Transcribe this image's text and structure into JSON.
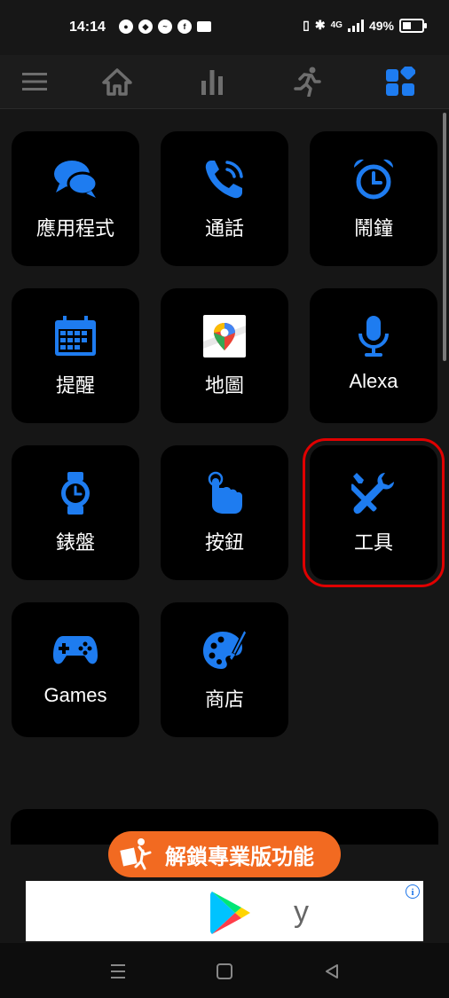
{
  "status_bar": {
    "time": "14:14",
    "notification_icons": [
      "line-icon",
      "discord-icon",
      "messenger-icon",
      "facebook-icon",
      "mail-icon"
    ],
    "network": "4G",
    "battery": "49%"
  },
  "navbar": {
    "items": [
      "menu-icon",
      "home-icon",
      "stats-icon",
      "running-icon",
      "apps-icon"
    ],
    "active": "apps-icon",
    "accent": "#1e7cf0"
  },
  "tiles": [
    {
      "label": "應用程式",
      "icon": "chat-bubbles-icon"
    },
    {
      "label": "通話",
      "icon": "phone-call-icon"
    },
    {
      "label": "鬧鐘",
      "icon": "alarm-clock-icon"
    },
    {
      "label": "提醒",
      "icon": "calendar-icon"
    },
    {
      "label": "地圖",
      "icon": "google-maps-icon"
    },
    {
      "label": "Alexa",
      "icon": "microphone-icon"
    },
    {
      "label": "錶盤",
      "icon": "watch-icon"
    },
    {
      "label": "按鈕",
      "icon": "tap-hand-icon"
    },
    {
      "label": "工具",
      "icon": "tools-icon",
      "highlighted": true
    },
    {
      "label": "Games",
      "icon": "gamepad-icon"
    },
    {
      "label": "商店",
      "icon": "palette-icon"
    }
  ],
  "unlock_button": {
    "label": "解鎖專業版功能",
    "color": "#f26a21"
  },
  "ad_banner": {
    "text": "y",
    "icon": "google-play-icon"
  },
  "system_nav": [
    "recent-apps-icon",
    "home-button-icon",
    "back-icon"
  ]
}
